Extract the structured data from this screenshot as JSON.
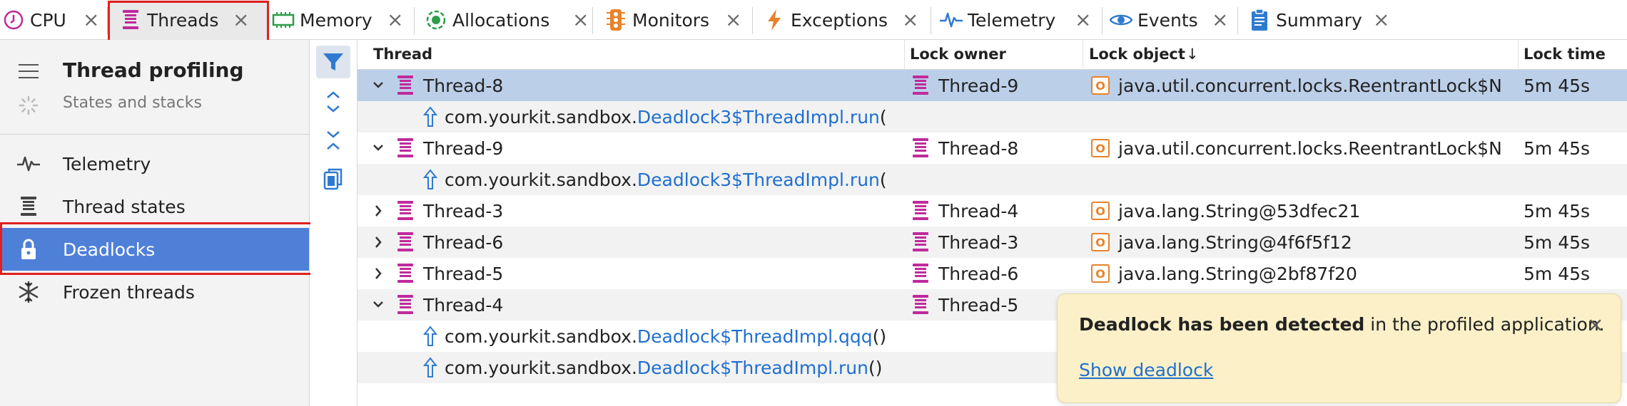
{
  "tabs": [
    {
      "label": "CPU",
      "icon": "clock-icon"
    },
    {
      "label": "Threads",
      "icon": "threads-icon"
    },
    {
      "label": "Memory",
      "icon": "memory-chip-icon"
    },
    {
      "label": "Allocations",
      "icon": "allocations-icon"
    },
    {
      "label": "Monitors",
      "icon": "traffic-light-icon"
    },
    {
      "label": "Exceptions",
      "icon": "lightning-icon"
    },
    {
      "label": "Telemetry",
      "icon": "pulse-icon"
    },
    {
      "label": "Events",
      "icon": "eye-icon"
    },
    {
      "label": "Summary",
      "icon": "clipboard-icon"
    }
  ],
  "active_tab": "Threads",
  "sidebar": {
    "title": "Thread profiling",
    "subtitle": "States and stacks",
    "items": [
      {
        "label": "Telemetry",
        "icon": "pulse-icon"
      },
      {
        "label": "Thread states",
        "icon": "thread-stack-icon"
      },
      {
        "label": "Deadlocks",
        "icon": "lock-icon",
        "selected": true
      },
      {
        "label": "Frozen threads",
        "icon": "snowflake-icon"
      }
    ]
  },
  "table": {
    "columns": {
      "thread": "Thread",
      "owner": "Lock owner",
      "object": "Lock object",
      "time": "Lock time"
    },
    "sort_indicator": "↓",
    "rows": [
      {
        "kind": "thread",
        "expanded": true,
        "thread": "Thread-8",
        "owner": "Thread-9",
        "object": "java.util.concurrent.locks.ReentrantLock$N",
        "time": "5m 45s",
        "selected": true
      },
      {
        "kind": "frame",
        "pkg": "com.yourkit.sandbox.",
        "link": "Deadlock3$ThreadImpl.run",
        "tail": "("
      },
      {
        "kind": "thread",
        "expanded": true,
        "thread": "Thread-9",
        "owner": "Thread-8",
        "object": "java.util.concurrent.locks.ReentrantLock$N",
        "time": "5m 45s"
      },
      {
        "kind": "frame",
        "pkg": "com.yourkit.sandbox.",
        "link": "Deadlock3$ThreadImpl.run",
        "tail": "("
      },
      {
        "kind": "thread",
        "expanded": false,
        "thread": "Thread-3",
        "owner": "Thread-4",
        "object": "java.lang.String@53dfec21",
        "time": "5m 45s"
      },
      {
        "kind": "thread",
        "expanded": false,
        "thread": "Thread-6",
        "owner": "Thread-3",
        "object": "java.lang.String@4f6f5f12",
        "time": "5m 45s"
      },
      {
        "kind": "thread",
        "expanded": false,
        "thread": "Thread-5",
        "owner": "Thread-6",
        "object": "java.lang.String@2bf87f20",
        "time": "5m 45s"
      },
      {
        "kind": "thread",
        "expanded": true,
        "thread": "Thread-4",
        "owner": "Thread-5",
        "object": "",
        "time": ""
      },
      {
        "kind": "frame",
        "pkg": "com.yourkit.sandbox.",
        "link": "Deadlock$ThreadImpl.qqq",
        "tail": "()"
      },
      {
        "kind": "frame",
        "pkg": "com.yourkit.sandbox.",
        "link": "Deadlock$ThreadImpl.run",
        "tail": "()"
      }
    ]
  },
  "notification": {
    "bold": "Deadlock has been detected",
    "rest": " in the profiled application.",
    "link": "Show deadlock",
    "close": "×"
  },
  "colors": {
    "accent": "#4f80d8",
    "thread_icon": "#c02a9c",
    "link": "#1f6fd0",
    "highlight_box": "#e02020",
    "notification_bg": "#fbf0c8",
    "lock_object": "#e8822b"
  }
}
